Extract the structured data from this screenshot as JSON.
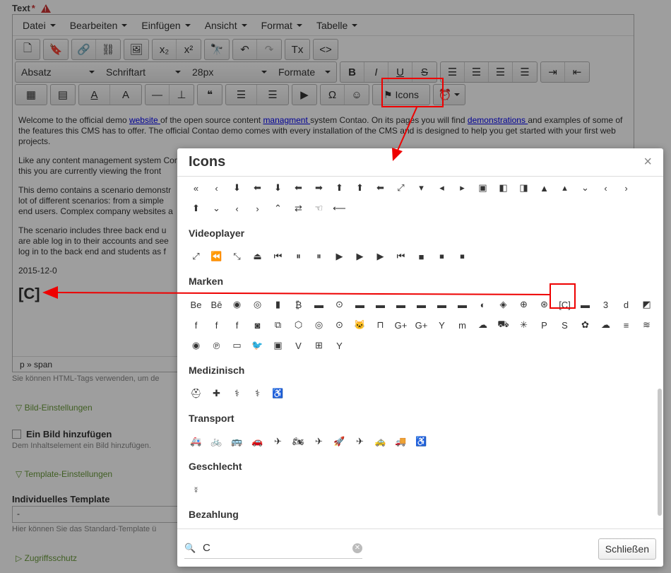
{
  "field": {
    "label": "Text",
    "required_mark": "*"
  },
  "menubar": [
    "Datei",
    "Bearbeiten",
    "Einfügen",
    "Ansicht",
    "Format",
    "Tabelle"
  ],
  "toolbar": {
    "row1": [
      "file-icon",
      "bookmark-icon",
      "link-icon",
      "unlink-icon",
      "image-icon",
      "subscript-icon",
      "superscript-icon",
      "find-icon",
      "undo-icon",
      "redo-icon",
      "clear-format-icon",
      "code-icon"
    ],
    "row1_glyphs": [
      "🗋",
      "🔖",
      "🔗",
      "⛓",
      "🖼",
      "x₂",
      "x²",
      "🔭",
      "↶",
      "↷",
      "Tx",
      "<>"
    ],
    "paragraph": "Absatz",
    "font_family": "Schriftart",
    "font_size": "28px",
    "formats": "Formate",
    "row2_glyphs": [
      "B",
      "I",
      "U",
      "S",
      "☰",
      "☰",
      "☰",
      "☰",
      "⇥",
      "⇤"
    ],
    "row3_glyphs": [
      "▦",
      "▤",
      "A",
      "A",
      "—",
      "⊥",
      "❝",
      "☰",
      "☰",
      "▶",
      "Ω",
      "☺"
    ],
    "icons_button": "Icons",
    "alarm_icon": "⏰"
  },
  "content": {
    "p1_a": "Welcome to the official demo ",
    "p1_link1": "website ",
    "p1_b": "of the open source content ",
    "p1_link2": "managment ",
    "p1_c": "system Contao. On its pages you will find ",
    "p1_link3": "demonstrations ",
    "p1_d": "and examples of some of the features this CMS has to offer. The official Contao demo comes with every installation of the CMS and is designed to help you get started with your first web projects.",
    "p2": "Like any content management system Cont",
    "p2b": "this you are currently viewing the front",
    "p3": "This demo contains a scenario demonstr",
    "p3b": "lot of different scenarios: from a simple",
    "p3c": "end users. Complex company websites a",
    "p4": "The scenario includes three back end u",
    "p4b": "are able log in to their accounts and see",
    "p4c": "log in to the back end and students as f",
    "date": "2015-12-0",
    "inserted_icon": "[C]"
  },
  "statusbar": {
    "path": "p » span"
  },
  "hints": {
    "html": "Sie können HTML-Tags verwenden, um de",
    "image": "Dem Inhaltselement ein Bild hinzufügen.",
    "template": "Hier können Sie das Standard-Template ü"
  },
  "legends": {
    "image_settings": "Bild-Einstellungen",
    "template_settings": "Template-Einstellungen",
    "access": "Zugriffsschutz"
  },
  "add_image": "Ein Bild hinzufügen",
  "template": {
    "label": "Individuelles Template",
    "value": "-"
  },
  "modal": {
    "title": "Icons",
    "close": "×",
    "row_top1": [
      "«",
      "‹",
      "⬇",
      "⬅",
      "⬇",
      "⬅",
      "➡",
      "⬆",
      "⬆",
      "⬅",
      "⤢",
      "▾",
      "◂",
      "▸",
      "▣",
      "◧",
      "◨",
      "▲",
      "▴",
      "⌄",
      "‹",
      "›"
    ],
    "row_top2": [
      "⬆",
      "⌄",
      "‹",
      "›",
      "⌃",
      "⇄",
      "☜",
      "⟵"
    ],
    "categories": {
      "video": "Videoplayer",
      "brands": "Marken",
      "medical": "Medizinisch",
      "transport": "Transport",
      "gender": "Geschlecht",
      "payment": "Bezahlung"
    },
    "video_icons": [
      "⤢",
      "⏪",
      "⤡",
      "⏏",
      "⏮",
      "⏸",
      "⏸",
      "▶",
      "▶",
      "▶",
      "⏮",
      "■",
      "⏹",
      "⏹"
    ],
    "brand_row1": [
      "Be",
      "Bē",
      "◉",
      "◎",
      "▮",
      "₿",
      "▬",
      "⊙",
      "▬",
      "▬",
      "▬",
      "▬",
      "▬",
      "▬",
      "◐",
      "◈",
      "⊕",
      "⊛",
      "[C]",
      "▬",
      "3",
      "d",
      "◩"
    ],
    "brand_row2": [
      "f",
      "f",
      "f",
      "◙",
      "⧉",
      "⬡",
      "◎",
      "⊙",
      "🐱",
      "⊓",
      "G+",
      "G+",
      "Y",
      "m",
      "☁",
      "⛟",
      "✳",
      "P",
      "S",
      "✿",
      "☁",
      "≡",
      "≋"
    ],
    "brand_row3": [
      "◉",
      "℗",
      "▭",
      "🐦",
      "▣",
      "V",
      "⊞",
      "Y"
    ],
    "medical_icons": [
      "⛑",
      "✚",
      "⚕",
      "⚕",
      "♿"
    ],
    "transport_icons": [
      "🚑",
      "🚲",
      "🚌",
      "🚗",
      "✈",
      "🏍",
      "✈",
      "🚀",
      "✈",
      "🚕",
      "🚚",
      "♿"
    ],
    "gender_icons": [
      "☿"
    ],
    "search_value": "C",
    "close_button": "Schließen"
  }
}
